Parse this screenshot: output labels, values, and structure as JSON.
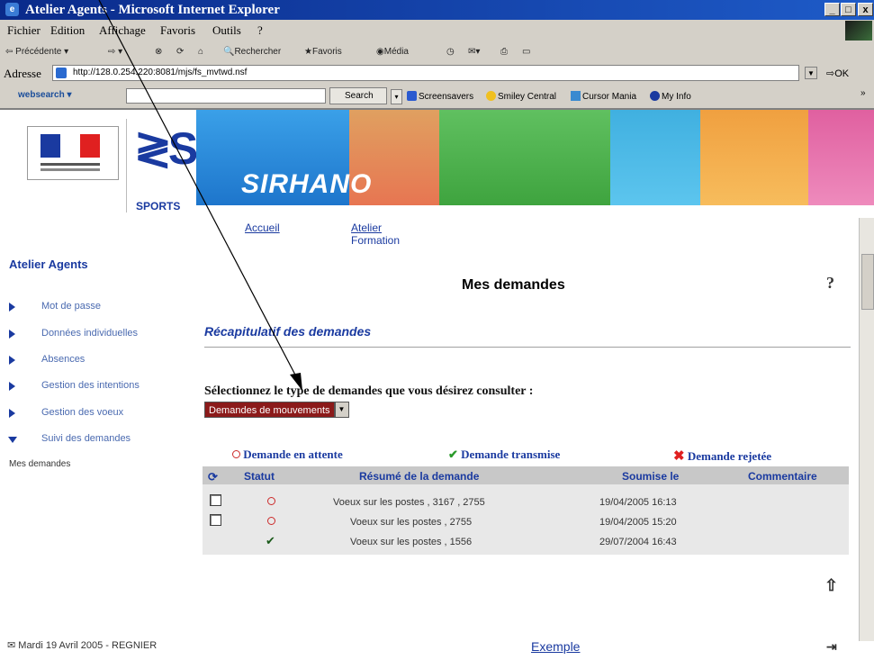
{
  "window": {
    "title": "Atelier Agents - Microsoft Internet Explorer",
    "min": "_",
    "max": "□",
    "close": "x"
  },
  "menu": [
    "Fichier",
    "Edition",
    "Affichage",
    "Favoris",
    "Outils",
    "?"
  ],
  "toolbar": {
    "back": "Précédente",
    "search": "Rechercher",
    "favorites": "Favoris",
    "media": "Média"
  },
  "address": {
    "label": "Adresse",
    "url": "http://128.0.254.220:8081/mjs/fs_mvtwd.nsf",
    "go": "OK"
  },
  "links": {
    "websearch": "websearch",
    "search_button": "Search",
    "items": [
      "Screensavers",
      "Smiley Central",
      "Cursor Mania",
      "My Info"
    ]
  },
  "banner": {
    "brand": "SPORTS",
    "title": "SIRHANO"
  },
  "topnav": {
    "home": "Accueil",
    "training_line1": "Atelier",
    "training_line2": "Formation"
  },
  "sidebar": {
    "title": "Atelier Agents",
    "items": [
      {
        "label": "Mot de passe"
      },
      {
        "label": "Données individuelles"
      },
      {
        "label": "Absences"
      },
      {
        "label": "Gestion des intentions"
      },
      {
        "label": "Gestion des voeux"
      },
      {
        "label": "Suivi des demandes"
      }
    ],
    "subitem": "Mes demandes"
  },
  "main": {
    "title": "Mes demandes",
    "help": "?",
    "section": "Récapitulatif des demandes",
    "select_prompt": "Sélectionnez le type de demandes que vous désirez consulter :",
    "select_value": "Demandes de mouvements"
  },
  "legend": {
    "pending": "Demande en attente",
    "sent": "Demande transmise",
    "rejected": "Demande rejetée"
  },
  "table": {
    "headers": {
      "status": "Statut",
      "summary": "Résumé de la demande",
      "submitted": "Soumise le",
      "comment": "Commentaire"
    },
    "rows": [
      {
        "status": "pending",
        "summary": "Voeux sur les postes , 3167 , 2755",
        "date": "19/04/2005 16:13",
        "checkbox": true
      },
      {
        "status": "pending",
        "summary": "Voeux sur les postes , 2755",
        "date": "19/04/2005 15:20",
        "checkbox": true
      },
      {
        "status": "sent",
        "summary": "Voeux sur les postes , 1556",
        "date": "29/07/2004 16:43",
        "checkbox": false
      }
    ]
  },
  "footer": {
    "date_user": "Mardi 19 Avril 2005 - REGNIER",
    "example": "Exemple"
  },
  "colors": {
    "sidebar_title": "#1a3aa0",
    "section": "#1a3aa0",
    "select_bg": "#8b1a1a",
    "sent": "#2a9a2a",
    "rejected": "#e02020",
    "header_bg": "#c8c8c8"
  }
}
